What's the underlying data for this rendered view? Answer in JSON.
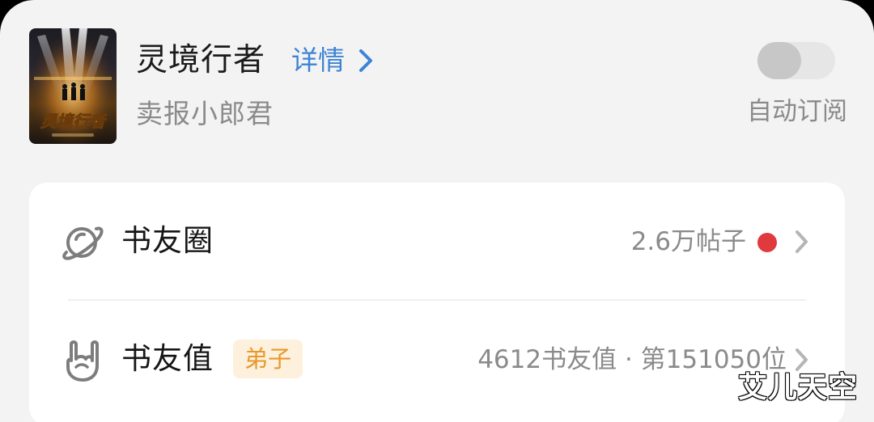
{
  "book": {
    "title": "灵境行者",
    "detail_label": "详情",
    "author": "卖报小郎君",
    "cover_title": "灵境行者"
  },
  "auto_subscribe": {
    "label": "自动订阅",
    "enabled": false
  },
  "rows": [
    {
      "label": "书友圈",
      "value": "2.6万帖子",
      "has_red_dot": true,
      "icon": "planet-icon"
    },
    {
      "label": "书友值",
      "badge": "弟子",
      "value": "4612书友值 · 第151050位",
      "icon": "rock-hand-icon"
    }
  ],
  "watermark": "艾儿天空",
  "colors": {
    "accent_blue": "#3d83d6",
    "badge_text": "#e69a2e",
    "badge_bg": "#fdf0dc",
    "red_dot": "#e0393e"
  }
}
